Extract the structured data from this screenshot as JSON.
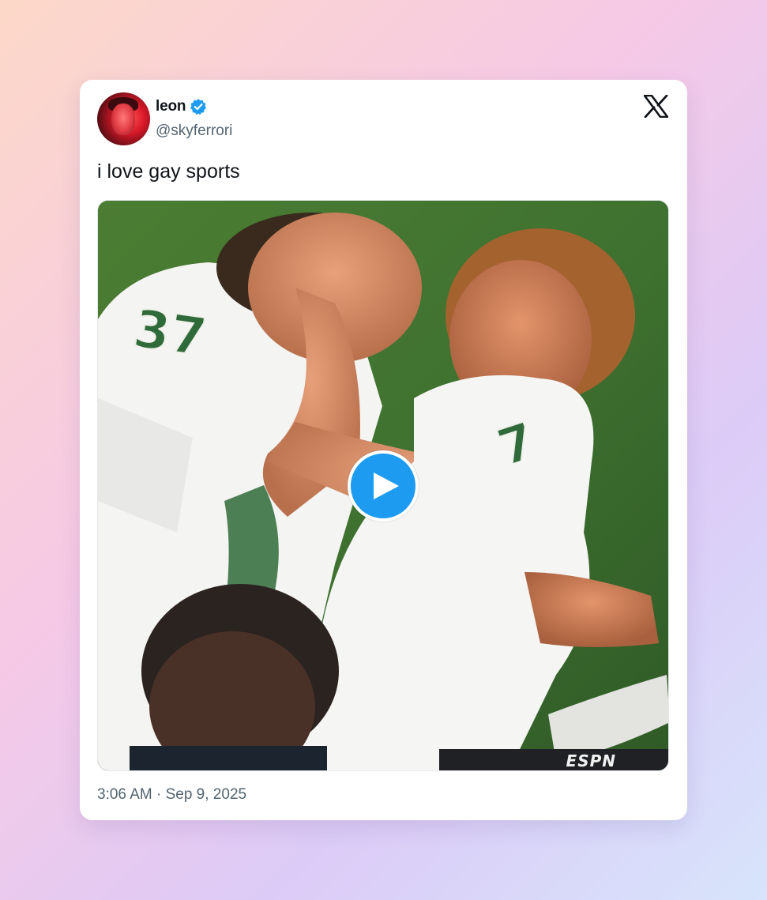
{
  "tweet": {
    "author": {
      "display_name": "leon",
      "handle": "@skyferrori",
      "verified": true
    },
    "text": "i love gay sports",
    "timestamp": "3:06 AM · Sep 9, 2025",
    "platform_icon": "x-logo-icon"
  },
  "media": {
    "type": "video",
    "play_icon": "play-icon",
    "jersey_numbers": [
      "37",
      "7"
    ],
    "broadcast_logo": "ESPN"
  },
  "colors": {
    "accent": "#1d9bf0",
    "text_primary": "#0f1419",
    "text_secondary": "#536471",
    "card_background": "#ffffff"
  }
}
